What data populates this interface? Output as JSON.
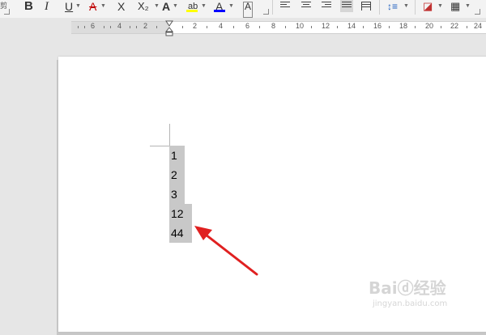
{
  "toolbar": {
    "left_cut": "剪",
    "bold": "B",
    "italic": "I",
    "underline": "U",
    "strike": "A",
    "clear_format": "X",
    "subscript": "X₂",
    "text_effect": "A",
    "highlight": "ab",
    "font_color": "A",
    "char_border": "A",
    "highlight_color": "#ffff00",
    "font_color_value": "#0000ff"
  },
  "ruler": {
    "labels": [
      "6",
      "4",
      "2",
      "2",
      "4",
      "6",
      "8",
      "10",
      "12",
      "14",
      "16",
      "18",
      "20",
      "22",
      "24"
    ]
  },
  "document": {
    "lines": [
      "1",
      "2",
      "3",
      "12",
      "44"
    ]
  },
  "annotation": {
    "arrow_color": "#e02020"
  },
  "watermark": {
    "brand": "Baiⓓ经验",
    "url": "jingyan.baidu.com"
  }
}
